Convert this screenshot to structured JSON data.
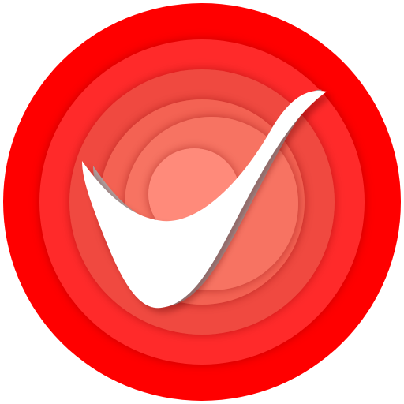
{
  "icon": {
    "name": "checkmark-app-icon",
    "rings": [
      {
        "name": "outer",
        "color": "#ff0000"
      },
      {
        "name": "ring-2",
        "color": "#ff2b2b"
      },
      {
        "name": "ring-3",
        "color": "#f04a40"
      },
      {
        "name": "ring-4",
        "color": "#f46252"
      },
      {
        "name": "ring-5",
        "color": "#f77362"
      },
      {
        "name": "inner",
        "color": "#ff8a7a"
      }
    ],
    "check_color": "#ffffff",
    "check_shadow_color": "#a9a9a9"
  }
}
